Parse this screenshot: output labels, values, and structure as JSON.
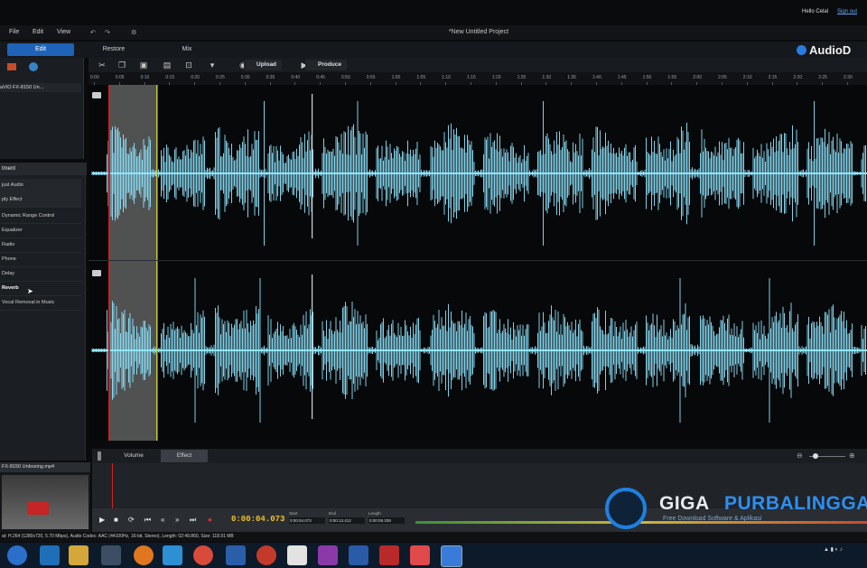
{
  "menu": {
    "file": "File",
    "edit": "Edit",
    "view": "View"
  },
  "window": {
    "title": "*New Untitled Project"
  },
  "account": {
    "hello": "Hello Celal",
    "sign_out": "Sign out"
  },
  "modes": {
    "edit": "Edit",
    "restore": "Restore",
    "mix": "Mix"
  },
  "brand": {
    "name": "AudioD"
  },
  "toolbar": {
    "upload": "Upload",
    "produce": "Produce"
  },
  "media": {
    "file_name": "aVIO FX-8150 Un...",
    "bottom_file": "FX-8150 Unboxing.mp4"
  },
  "effects": {
    "header": "tment",
    "items": [
      "just Audio",
      "ply Effect",
      "Dynamic Range Control",
      "Equalizer",
      "Radio",
      "Phone",
      "Delay",
      "Reverb",
      "Vocal Removal in Music"
    ]
  },
  "ruler": {
    "ticks": [
      "0:00",
      "0:05",
      "0:10",
      "0:15",
      "0:20",
      "0:25",
      "0:30",
      "0:35",
      "0:40",
      "0:45",
      "0:50",
      "0:55",
      "1:00",
      "1:05",
      "1:10",
      "1:15",
      "1:20",
      "1:25",
      "1:30",
      "1:35",
      "1:40",
      "1:45",
      "1:50",
      "1:55",
      "2:00",
      "2:05",
      "2:10",
      "2:15",
      "2:20",
      "2:25",
      "2:30"
    ]
  },
  "tabs": {
    "volume": "Volume",
    "effect": "Effect"
  },
  "transport": {
    "time": "0:00:04.073",
    "start_label": "Start",
    "start_value": "0:00:04.073",
    "end_label": "End",
    "end_value": "0:00:13.412",
    "length_label": "Length",
    "length_value": "0:00:09.339"
  },
  "status": {
    "text": "at: H.264 (1280x720, 5.70 Mbps), Audio Codec: AAC (44100Hz, 16-bit, Stereo), Length: 02:49.860, Size: 118.91 MB"
  },
  "watermark": {
    "giga": "GIGA",
    "purbalingga": "PURBALINGGA",
    "tagline": "Free Download Software & Aplikasi"
  },
  "colors": {
    "accent": "#1e63b8",
    "waveform": "#8fe6ff",
    "selection": "#6f6f6f",
    "playhead": "#d21f1f",
    "marker": "#c9c93a"
  }
}
